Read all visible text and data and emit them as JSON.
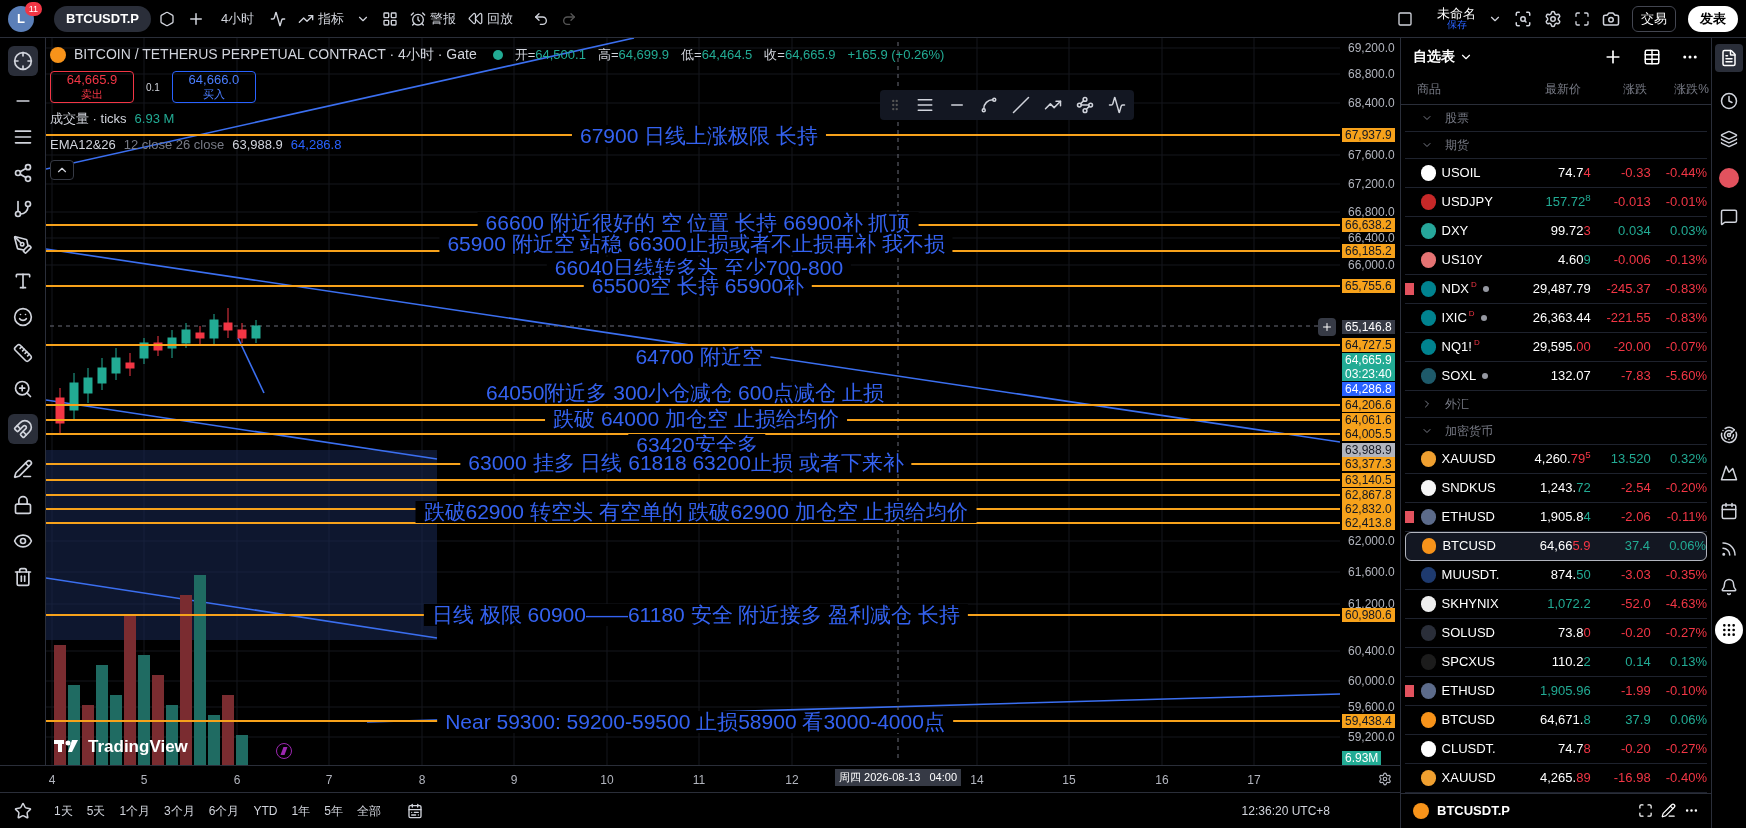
{
  "topbar": {
    "avatar": "L",
    "notifications": "11",
    "symbol": "BTCUSDT.P",
    "interval": "4小时",
    "indicators": "指标",
    "alert": "警报",
    "replay": "回放",
    "layout_name": "未命名",
    "save_hint": "保存",
    "trade_button": "交易",
    "publish_button": "发表"
  },
  "header": {
    "title": "BITCOIN / TETHERUS PERPETUAL CONTRACT · 4小时 · Gate",
    "market_open": true,
    "ohlc": [
      {
        "label": "开=",
        "value": "64,500.1"
      },
      {
        "label": "高=",
        "value": "64,699.9"
      },
      {
        "label": "低=",
        "value": "64,464.5"
      },
      {
        "label": "收=",
        "value": "64,665.9"
      }
    ],
    "change": "+165.9 (+0.26%)"
  },
  "trade": {
    "sell_price": "64,665.9",
    "sell_label": "卖出",
    "spread": "0.1",
    "buy_price": "64,666.0",
    "buy_label": "买入"
  },
  "indicators": [
    {
      "kind": "volume",
      "name": "成交量 · ticks",
      "values": [
        "6.93 M"
      ]
    },
    {
      "kind": "ema",
      "name": "EMA12&26",
      "params": "12 close 26 close",
      "values": [
        "63,988.9",
        "64,286.8"
      ]
    }
  ],
  "annotations": [
    "67900 日线上涨极限 长持",
    "66600  附近很好的 空  位置  长持 66900补   抓顶",
    "65900 附近空  站稳  66300止损或者不止损再补  我不损",
    "66040日线转多头       至少700-800",
    "65500空 长持     65900补",
    "64700 附近空",
    "64050附近多 300小仓减仓 600点减仓 止损",
    "跌破 64000  加仓空  止损给均价",
    "63420安全多",
    "63000  挂多  日线 61818  63200止损 或者下来补",
    "跌破62900 转空头    有空单的 跌破62900 加仓空 止损给均价",
    "日线  极限  60900——61180 安全  附近接多   盈利减仓 长持",
    "Near 59300: 59200-59500  止损58900 看3000-4000点"
  ],
  "price_axis": {
    "ticks": [
      "69,200.0",
      "68,800.0",
      "68,400.0",
      "67,600.0",
      "67,200.0",
      "66,800.0",
      "66,400.0",
      "66,000.0",
      "62,000.0",
      "61,600.0",
      "61,200.0",
      "60,400.0",
      "60,000.0",
      "59,600.0",
      "59,200.0"
    ],
    "tags": [
      {
        "kind": "level",
        "label": "67,937.9"
      },
      {
        "kind": "level",
        "label": "66,638.2"
      },
      {
        "kind": "level",
        "label": "66,185.2"
      },
      {
        "kind": "level",
        "label": "65,755.6"
      },
      {
        "kind": "crosshair",
        "label": "65,146.8"
      },
      {
        "kind": "level",
        "label": "64,727.5"
      },
      {
        "kind": "last",
        "label": "64,665.9",
        "countdown": "03:23:40"
      },
      {
        "kind": "ema_slow",
        "label": "64,286.8"
      },
      {
        "kind": "level",
        "label": "64,206.6"
      },
      {
        "kind": "level",
        "label": "64,061.6"
      },
      {
        "kind": "level",
        "label": "64,005.5"
      },
      {
        "kind": "ema_fast",
        "label": "63,988.9"
      },
      {
        "kind": "level",
        "label": "63,377.3"
      },
      {
        "kind": "level",
        "label": "63,140.5"
      },
      {
        "kind": "level",
        "label": "62,867.8"
      },
      {
        "kind": "level",
        "label": "62,832.0"
      },
      {
        "kind": "level",
        "label": "62,413.8"
      },
      {
        "kind": "level",
        "label": "60,980.6"
      },
      {
        "kind": "level",
        "label": "59,438.4"
      },
      {
        "kind": "volume",
        "label": "6.93M"
      }
    ]
  },
  "logo": "TradingView",
  "time_axis": {
    "labels": [
      "4",
      "5",
      "6",
      "7",
      "8",
      "9",
      "10",
      "11",
      "12",
      "14",
      "15",
      "16",
      "17"
    ],
    "crosshair": "周四 2026-08-13   04:00"
  },
  "bottom_bar": {
    "ranges": [
      "1天",
      "5天",
      "1个月",
      "3个月",
      "6个月",
      "YTD",
      "1年",
      "5年",
      "全部"
    ],
    "clock": "12:36:20 UTC+8"
  },
  "watchlist": {
    "title": "自选表",
    "columns": [
      "商品",
      "最新价",
      "涨跌",
      "涨跌%"
    ],
    "sections": [
      {
        "title": "股票",
        "expanded": true
      },
      {
        "title": "期货",
        "expanded": true,
        "rows": [
          {
            "symbol": "USOIL",
            "price_head": "74.7",
            "price_tail": "4",
            "tick_up": false,
            "change": "-0.33",
            "change_pct": "-0.44%",
            "change_up": false,
            "color": "#ffffff",
            "flagged": false,
            "dot": false,
            "selected": false
          },
          {
            "symbol": "USDJPY",
            "price_tail": "157.72$^{8}$",
            "tick_up": true,
            "change": "-0.013",
            "change_pct": "-0.01%",
            "change_up": false,
            "color": "#c62828",
            "flagged": false,
            "dot": false,
            "selected": false
          },
          {
            "symbol": "DXY",
            "price_head": "99.72",
            "price_tail": "3",
            "tick_up": false,
            "change": "0.034",
            "change_pct": "0.03%",
            "change_up": true,
            "color": "#26a69a",
            "flagged": false,
            "dot": false,
            "selected": false
          },
          {
            "symbol": "US10Y",
            "price_head": "4.60",
            "price_tail": "9",
            "tick_up": true,
            "change": "-0.006",
            "change_pct": "-0.13%",
            "change_up": false,
            "color": "#e57373",
            "flagged": false,
            "dot": false,
            "selected": false
          },
          {
            "symbol": "NDX",
            "badge": "D",
            "price_head": "29,487.79",
            "change": "-245.37",
            "change_pct": "-0.83%",
            "change_up": false,
            "color": "#00838f",
            "flagged": true,
            "dot": true,
            "selected": false
          },
          {
            "symbol": "IXIC",
            "badge": "D",
            "price_head": "26,363.44",
            "change": "-221.55",
            "change_pct": "-0.83%",
            "change_up": false,
            "color": "#00838f",
            "flagged": false,
            "dot": true,
            "selected": false
          },
          {
            "symbol": "NQ1!",
            "badge": "D",
            "price_head": "29,595.",
            "price_tail": "00",
            "tick_up": false,
            "change": "-20.00",
            "change_pct": "-0.07%",
            "change_up": false,
            "color": "#00838f",
            "flagged": false,
            "dot": false,
            "selected": false
          },
          {
            "symbol": "SOXL",
            "price_head": "132.07",
            "change": "-7.83",
            "change_pct": "-5.60%",
            "change_up": false,
            "color": "#1e5a6a",
            "flagged": false,
            "dot": true,
            "selected": false
          }
        ]
      },
      {
        "title": "外汇",
        "expanded": false
      },
      {
        "title": "加密货币",
        "expanded": true,
        "rows": [
          {
            "symbol": "XAUUSD",
            "price_head": "4,260.",
            "price_tail": "79$^{5}$",
            "tick_up": false,
            "change": "13.520",
            "change_pct": "0.32%",
            "change_up": true,
            "color": "#f0a030",
            "flagged": false,
            "dot": false,
            "selected": false
          },
          {
            "symbol": "SNDKUS",
            "price_head": "1,243.",
            "price_tail": "72",
            "tick_up": true,
            "change": "-2.54",
            "change_pct": "-0.20%",
            "change_up": false,
            "color": "#f5f5f5",
            "flagged": false,
            "dot": false,
            "selected": false
          },
          {
            "symbol": "ETHUSD",
            "price_head": "1,905.8",
            "price_tail": "4",
            "tick_up": true,
            "change": "-2.06",
            "change_pct": "-0.11%",
            "change_up": false,
            "color": "#5c6b8a",
            "flagged": true,
            "dot": false,
            "selected": false
          },
          {
            "symbol": "BTCUSD",
            "price_head": "64,66",
            "price_tail": "5.9",
            "tick_up": false,
            "change": "37.4",
            "change_pct": "0.06%",
            "change_up": true,
            "color": "#f7931a",
            "flagged": false,
            "dot": false,
            "selected": true
          },
          {
            "symbol": "MUUSDT.",
            "price_head": "874.",
            "price_tail": "50",
            "tick_up": true,
            "change": "-3.03",
            "change_pct": "-0.35%",
            "change_up": false,
            "color": "#1e3a6e",
            "flagged": false,
            "dot": false,
            "selected": false
          },
          {
            "symbol": "SKHYNIX",
            "price_tail": "1,072.2",
            "tick_up": true,
            "change": "-52.0",
            "change_pct": "-4.63%",
            "change_up": false,
            "color": "#eeeeee",
            "flagged": false,
            "dot": false,
            "selected": false
          },
          {
            "symbol": "SOLUSD",
            "price_head": "73.8",
            "price_tail": "0",
            "tick_up": false,
            "change": "-0.20",
            "change_pct": "-0.27%",
            "change_up": false,
            "color": "#2a2e39",
            "flagged": false,
            "dot": false,
            "selected": false
          },
          {
            "symbol": "SPCXUS",
            "price_head": "110.2",
            "price_tail": "2",
            "tick_up": true,
            "change": "0.14",
            "change_pct": "0.13%",
            "change_up": true,
            "color": "#1c1c1c",
            "flagged": false,
            "dot": false,
            "selected": false
          },
          {
            "symbol": "ETHUSD",
            "price_tail": "1,905.96",
            "tick_up": true,
            "change": "-1.99",
            "change_pct": "-0.10%",
            "change_up": false,
            "color": "#5c6b8a",
            "flagged": true,
            "dot": false,
            "selected": false
          },
          {
            "symbol": "BTCUSD",
            "price_head": "64,671.",
            "price_tail": "8",
            "tick_up": true,
            "change": "37.9",
            "change_pct": "0.06%",
            "change_up": true,
            "color": "#f7931a",
            "flagged": false,
            "dot": false,
            "selected": false
          },
          {
            "symbol": "CLUSDT.",
            "price_head": "74.7",
            "price_tail": "8",
            "tick_up": false,
            "change": "-0.20",
            "change_pct": "-0.27%",
            "change_up": false,
            "color": "#ffffff",
            "flagged": false,
            "dot": false,
            "selected": false
          },
          {
            "symbol": "XAUUSD",
            "price_head": "4,265.",
            "price_tail": "89",
            "tick_up": false,
            "change": "-16.98",
            "change_pct": "-0.40%",
            "change_up": false,
            "color": "#f0a030",
            "flagged": false,
            "dot": false,
            "selected": false
          }
        ]
      }
    ],
    "footer_symbol": "BTCUSDT.P"
  }
}
